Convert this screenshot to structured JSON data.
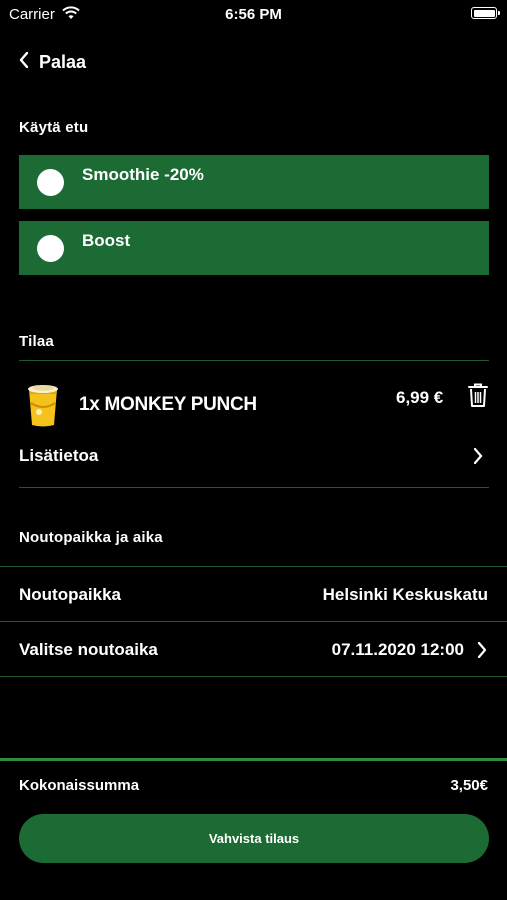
{
  "status_bar": {
    "carrier": "Carrier",
    "time": "6:56 PM"
  },
  "nav": {
    "back_label": "Palaa"
  },
  "benefit": {
    "title": "Käytä etu",
    "options": [
      {
        "label": "Smoothie -20%"
      },
      {
        "label": "Boost"
      }
    ]
  },
  "order": {
    "title": "Tilaa",
    "item_name": "1x MONKEY PUNCH",
    "item_price": "6,99 €",
    "more_info_label": "Lisätietoa"
  },
  "pickup": {
    "title": "Noutopaikka ja aika",
    "location_label": "Noutopaikka",
    "location_value": "Helsinki Keskuskatu",
    "time_label": "Valitse noutoaika",
    "time_value": "07.11.2020 12:00"
  },
  "summary": {
    "total_label": "Kokonaissumma",
    "total_value": "3,50€",
    "confirm_label": "Vahvista tilaus"
  },
  "colors": {
    "accent_green": "#1d6b34",
    "divider_green": "#1f5a2d",
    "bar_green": "#2f8a3f"
  }
}
